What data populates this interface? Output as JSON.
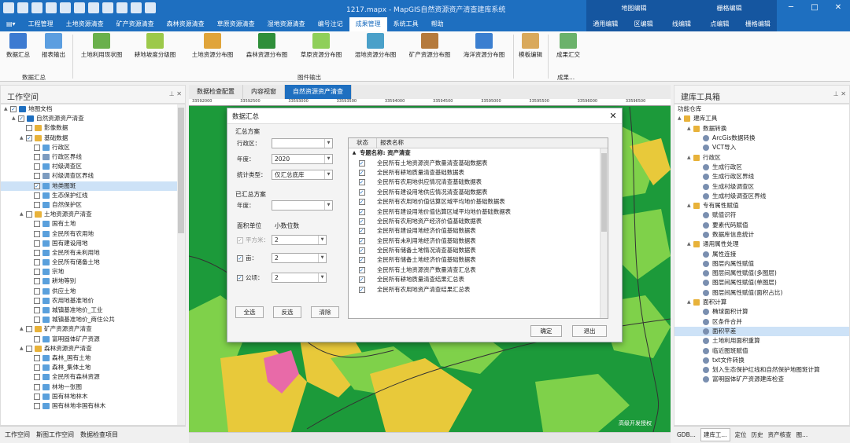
{
  "window": {
    "title": "1217.mapx - MapGIS自然资源资产清查建库系统",
    "context_tabs": [
      "地图编辑",
      "栅格编辑"
    ]
  },
  "menu": {
    "items": [
      "工程管理",
      "土地资源清查",
      "矿产资源清查",
      "森林资源清查",
      "草原资源清查",
      "湿地资源清查",
      "编号注记",
      "成果管理",
      "系统工具",
      "帮助"
    ],
    "active_index": 7,
    "right_items": [
      "通用编辑",
      "区编辑",
      "线编辑",
      "点编辑",
      "栅格编辑"
    ]
  },
  "ribbon": {
    "buttons": [
      "数据汇总",
      "报表输出",
      "土地利用现状图",
      "耕地坡度分级图",
      "土地资源分布图",
      "森林资源分布图",
      "草原资源分布图",
      "湿地资源分布图",
      "矿产资源分布图",
      "海洋资源分布图",
      "模板编辑",
      "成果汇交"
    ],
    "groups": [
      "数据汇总",
      "图件输出",
      "成果..."
    ]
  },
  "workspace": {
    "title": "工作空间",
    "tree": [
      {
        "label": "地图文档",
        "level": 0,
        "check": "on",
        "icon": "map",
        "toggle": "▲"
      },
      {
        "label": "自然资源资产清查",
        "level": 1,
        "check": "on",
        "icon": "map",
        "toggle": "▲"
      },
      {
        "label": "影像数据",
        "level": 2,
        "check": "off",
        "icon": "folder",
        "toggle": ""
      },
      {
        "label": "基础数据",
        "level": 2,
        "check": "on",
        "icon": "folder",
        "toggle": "▲"
      },
      {
        "label": "行政区",
        "level": 3,
        "check": "off",
        "icon": "region",
        "toggle": ""
      },
      {
        "label": "行政区界线",
        "level": 3,
        "check": "off",
        "icon": "line",
        "toggle": ""
      },
      {
        "label": "村级调查区",
        "level": 3,
        "check": "off",
        "icon": "region",
        "toggle": ""
      },
      {
        "label": "村级调查区界线",
        "level": 3,
        "check": "off",
        "icon": "line",
        "toggle": ""
      },
      {
        "label": "地类图斑",
        "level": 3,
        "check": "on",
        "icon": "region",
        "toggle": "",
        "selected": true
      },
      {
        "label": "生态保护红线",
        "level": 3,
        "check": "off",
        "icon": "region",
        "toggle": ""
      },
      {
        "label": "自然保护区",
        "level": 3,
        "check": "off",
        "icon": "region",
        "toggle": ""
      },
      {
        "label": "土地资源资产清查",
        "level": 2,
        "check": "off",
        "icon": "folder",
        "toggle": "▲"
      },
      {
        "label": "国有土地",
        "level": 3,
        "check": "off",
        "icon": "region",
        "toggle": ""
      },
      {
        "label": "全民所有农用地",
        "level": 3,
        "check": "off",
        "icon": "region",
        "toggle": ""
      },
      {
        "label": "国有建设用地",
        "level": 3,
        "check": "off",
        "icon": "region",
        "toggle": ""
      },
      {
        "label": "全民所有未利用地",
        "level": 3,
        "check": "off",
        "icon": "region",
        "toggle": ""
      },
      {
        "label": "全民所有储备土地",
        "level": 3,
        "check": "off",
        "icon": "region",
        "toggle": ""
      },
      {
        "label": "宗地",
        "level": 3,
        "check": "off",
        "icon": "region",
        "toggle": ""
      },
      {
        "label": "耕地等别",
        "level": 3,
        "check": "off",
        "icon": "region",
        "toggle": ""
      },
      {
        "label": "供应土地",
        "level": 3,
        "check": "off",
        "icon": "region",
        "toggle": ""
      },
      {
        "label": "农用地基准地价",
        "level": 3,
        "check": "off",
        "icon": "region",
        "toggle": ""
      },
      {
        "label": "城镇基准地价_工业",
        "level": 3,
        "check": "off",
        "icon": "region",
        "toggle": ""
      },
      {
        "label": "城镇基准地价_商住公共",
        "level": 3,
        "check": "off",
        "icon": "region",
        "toggle": ""
      },
      {
        "label": "矿产资源资产清查",
        "level": 2,
        "check": "off",
        "icon": "folder",
        "toggle": "▲"
      },
      {
        "label": "富明固体矿产资源",
        "level": 3,
        "check": "off",
        "icon": "region",
        "toggle": ""
      },
      {
        "label": "森林资源资产清查",
        "level": 2,
        "check": "off",
        "icon": "folder",
        "toggle": "▲"
      },
      {
        "label": "森林_国有土地",
        "level": 3,
        "check": "off",
        "icon": "region",
        "toggle": ""
      },
      {
        "label": "森林_集体土地",
        "level": 3,
        "check": "off",
        "icon": "region",
        "toggle": ""
      },
      {
        "label": "全民所有森林资源",
        "level": 3,
        "check": "off",
        "icon": "region",
        "toggle": ""
      },
      {
        "label": "林地一张图",
        "level": 3,
        "check": "off",
        "icon": "region",
        "toggle": ""
      },
      {
        "label": "国有林地林木",
        "level": 3,
        "check": "off",
        "icon": "region",
        "toggle": ""
      },
      {
        "label": "国有林地非国有林木",
        "level": 3,
        "check": "off",
        "icon": "region",
        "toggle": ""
      }
    ],
    "bottom_tabs": [
      "工作空间",
      "斯图工作空间",
      "数据检查项目"
    ]
  },
  "documents": {
    "tabs": [
      "数据检查配置",
      "内容视窗",
      "自然资源资产清查"
    ],
    "active_index": 2
  },
  "map": {
    "ruler_ticks": [
      "33592000",
      "33592500",
      "33593000",
      "33593500",
      "33594000",
      "33594500",
      "33595000",
      "33595500",
      "33596000",
      "33596500"
    ],
    "watermark": "高级开发授权"
  },
  "dialog": {
    "title": "数据汇总",
    "scheme_section": "汇总方案",
    "district_label": "行政区：",
    "district_value": "",
    "year_label": "年度：",
    "year_value": "2020",
    "stat_type_label": "统计类型：",
    "stat_type_value": "仅汇总底库",
    "summarized_section": "已汇总方案",
    "summarized_year_label": "年度：",
    "area_unit_header": "面积单位",
    "decimal_header": "小数位数",
    "units": [
      {
        "label": "平方米：",
        "decimal": "2",
        "checked": true,
        "disabled": true
      },
      {
        "label": "亩：",
        "decimal": "2",
        "checked": true,
        "disabled": false
      },
      {
        "label": "公顷：",
        "decimal": "2",
        "checked": true,
        "disabled": false
      }
    ],
    "select_all": "全选",
    "invert": "反选",
    "clear": "清除",
    "ok": "确定",
    "exit": "退出",
    "grid": {
      "headers": [
        "状态",
        "报表名称"
      ],
      "group": "专题名称: 资产清查",
      "rows": [
        "全民所有土地资源资产数量清查基础数据表",
        "全民所有耕地质量清查基础数据表",
        "全民所有农用地供应情况清查基础数据表",
        "全民所有建设用地供应情况清查基础数据表",
        "全民所有农用地价值估算区域平均地价基础数据表",
        "全民所有建设用地价值估算区域平均地价基础数据表",
        "全民所有农用地资产经济价值基础数据表",
        "全民所有建设用地经济价值基础数据表",
        "全民所有未利用地经济价值基础数据表",
        "全民所有储备土地情况清查基础数据表",
        "全民所有储备土地经济价值基础数据表",
        "全民所有土地资源资产数量清查汇总表",
        "全民所有耕地质量清查结果汇总表",
        "全民所有农用地资产清查结果汇总表"
      ]
    }
  },
  "toolbox": {
    "title": "建库工具箱",
    "rows": [
      {
        "label": "功能仓库",
        "level": 0,
        "type": "text"
      },
      {
        "label": "建库工具",
        "level": 0,
        "type": "folder",
        "toggle": "▲"
      },
      {
        "label": "数据转换",
        "level": 1,
        "type": "folder",
        "toggle": "▲"
      },
      {
        "label": "ArcGis数据转换",
        "level": 2,
        "type": "tool"
      },
      {
        "label": "VCT导入",
        "level": 2,
        "type": "tool"
      },
      {
        "label": "行政区",
        "level": 1,
        "type": "folder",
        "toggle": "▲"
      },
      {
        "label": "生成行政区",
        "level": 2,
        "type": "tool"
      },
      {
        "label": "生成行政区界线",
        "level": 2,
        "type": "tool"
      },
      {
        "label": "生成村级调查区",
        "level": 2,
        "type": "tool"
      },
      {
        "label": "生成村级调查区界线",
        "level": 2,
        "type": "tool"
      },
      {
        "label": "专有属性赋值",
        "level": 1,
        "type": "folder",
        "toggle": "▲"
      },
      {
        "label": "赋值识符",
        "level": 2,
        "type": "tool"
      },
      {
        "label": "要素代码赋值",
        "level": 2,
        "type": "tool"
      },
      {
        "label": "数据库信息统计",
        "level": 2,
        "type": "tool"
      },
      {
        "label": "通用属性处理",
        "level": 1,
        "type": "folder",
        "toggle": "▲"
      },
      {
        "label": "属性连接",
        "level": 2,
        "type": "tool"
      },
      {
        "label": "图层内属性赋值",
        "level": 2,
        "type": "tool"
      },
      {
        "label": "图层间属性赋值(多图层)",
        "level": 2,
        "type": "tool"
      },
      {
        "label": "图层间属性赋值(单图层)",
        "level": 2,
        "type": "tool"
      },
      {
        "label": "图层间属性赋值(面积占比)",
        "level": 2,
        "type": "tool"
      },
      {
        "label": "面积计算",
        "level": 1,
        "type": "folder",
        "toggle": "▲"
      },
      {
        "label": "椭球面积计算",
        "level": 2,
        "type": "tool"
      },
      {
        "label": "区条件合并",
        "level": 2,
        "type": "tool"
      },
      {
        "label": "面积平差",
        "level": 2,
        "type": "tool",
        "selected": true
      },
      {
        "label": "土地利用面积重算",
        "level": 2,
        "type": "tool"
      },
      {
        "label": "临近图斑赋值",
        "level": 2,
        "type": "tool"
      },
      {
        "label": "txt文件转换",
        "level": 2,
        "type": "tool"
      },
      {
        "label": "划入生态保护红线和自然保护地图斑计算",
        "level": 2,
        "type": "tool"
      },
      {
        "label": "富明固体矿产资源建库检查",
        "level": 2,
        "type": "tool"
      }
    ],
    "bottom_tabs": [
      "GDB...",
      "建库工...",
      "定位",
      "历史",
      "资产核查",
      "图..."
    ]
  },
  "colors": {
    "brand": "#1e6fc0",
    "map_green": "#1c9a3a",
    "map_light": "#7fd14a",
    "map_yellow": "#e8c93a",
    "map_pink": "#e86aa8"
  }
}
